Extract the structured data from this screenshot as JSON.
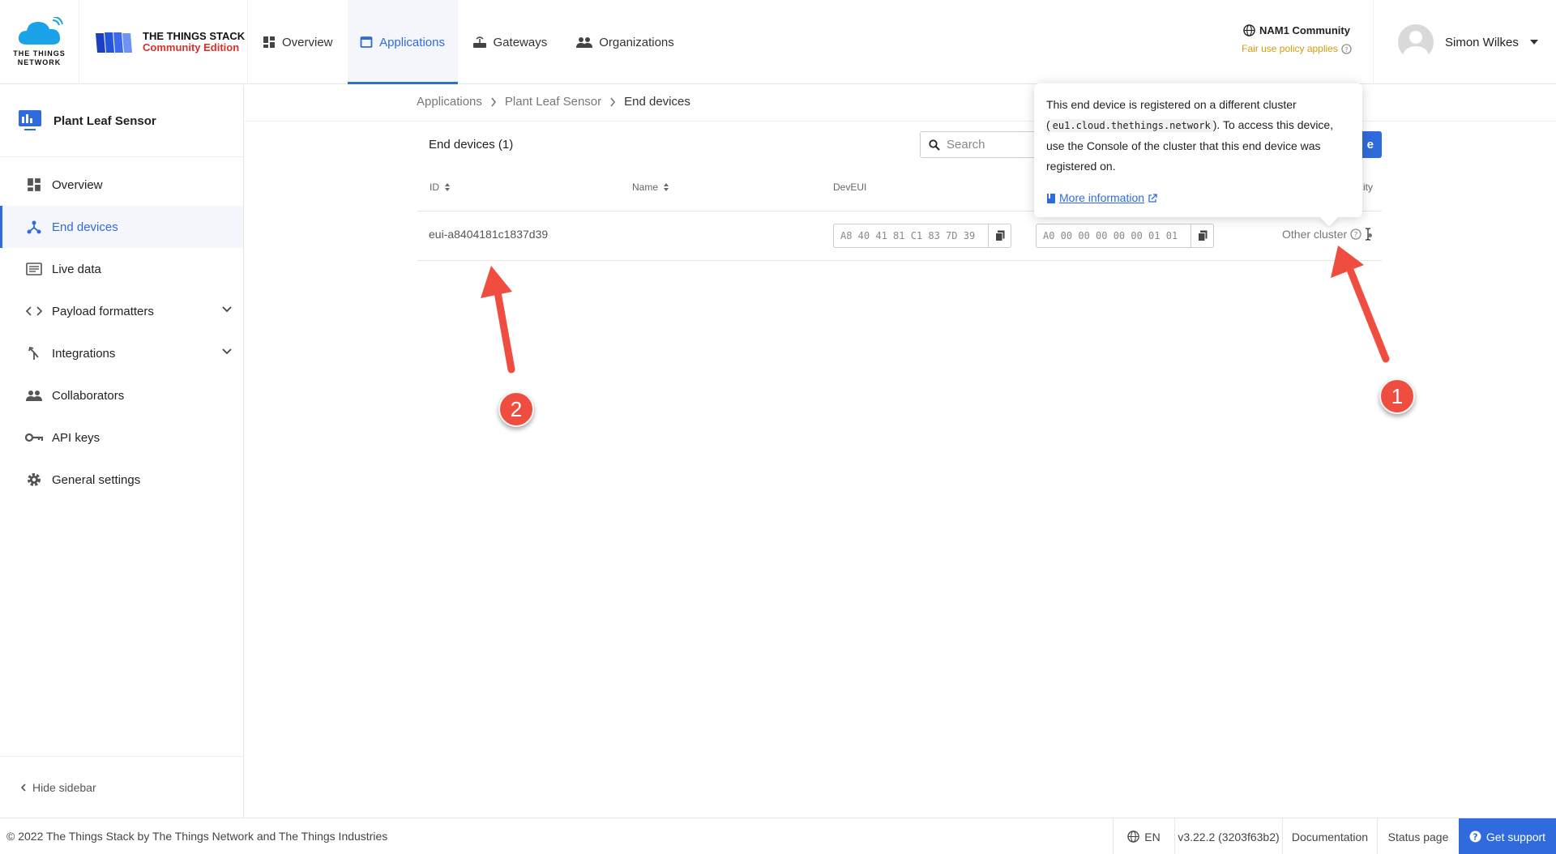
{
  "header": {
    "ttn_logo_text": [
      "THE THINGS",
      "NETWORK"
    ],
    "stack_name": "THE THINGS STACK",
    "stack_edition": "Community Edition",
    "nav": [
      {
        "label": "Overview",
        "icon": "dashboard-icon"
      },
      {
        "label": "Applications",
        "icon": "application-icon",
        "active": true
      },
      {
        "label": "Gateways",
        "icon": "router-icon"
      },
      {
        "label": "Organizations",
        "icon": "people-icon"
      }
    ],
    "cluster_name": "NAM1 Community",
    "fair_use": "Fair use policy applies",
    "user_name": "Simon Wilkes"
  },
  "sidebar": {
    "app_name": "Plant Leaf Sensor",
    "items": [
      {
        "label": "Overview",
        "icon": "dashboard-icon"
      },
      {
        "label": "End devices",
        "icon": "device-hub-icon",
        "active": true
      },
      {
        "label": "Live data",
        "icon": "list-icon"
      },
      {
        "label": "Payload formatters",
        "icon": "code-icon",
        "expandable": true
      },
      {
        "label": "Integrations",
        "icon": "merge-icon",
        "expandable": true
      },
      {
        "label": "Collaborators",
        "icon": "people-icon"
      },
      {
        "label": "API keys",
        "icon": "key-icon"
      },
      {
        "label": "General settings",
        "icon": "gear-icon"
      }
    ],
    "hide_label": "Hide sidebar"
  },
  "breadcrumb": [
    "Applications",
    "Plant Leaf Sensor",
    "End devices"
  ],
  "table": {
    "title": "End devices (1)",
    "search_placeholder": "Search",
    "add_label": "e",
    "columns": {
      "id": "ID",
      "name": "Name",
      "dev_eui": "DevEUI",
      "activity": "ity"
    },
    "rows": [
      {
        "id": "eui-a8404181c1837d39",
        "dev_eui": "A8 40 41 81 C1 83 7D 39",
        "join_eui": "A0 00 00 00 00 00 01 01",
        "status": "Other cluster"
      }
    ]
  },
  "tooltip": {
    "line1": "This end device is registered on a different cluster",
    "open_paren": "(",
    "cluster_code": "eu1.cloud.thethings.network",
    "line2_rest": "). To access this device,",
    "line3": "use the Console of the cluster that this end device was",
    "line4": "registered on.",
    "more_link": "More information"
  },
  "annotations": [
    {
      "label": "1"
    },
    {
      "label": "2"
    }
  ],
  "footer": {
    "copyright": "© 2022 The Things Stack by The Things Network and The Things Industries",
    "language": "EN",
    "version": "v3.22.2 (3203f63b2)",
    "documentation": "Documentation",
    "status_page": "Status page",
    "support": "Get support"
  },
  "colors": {
    "accent": "#2f6bdc",
    "brand_red": "#d6302b",
    "annotation": "#ee4d3f",
    "fair_use": "#d49a10"
  }
}
